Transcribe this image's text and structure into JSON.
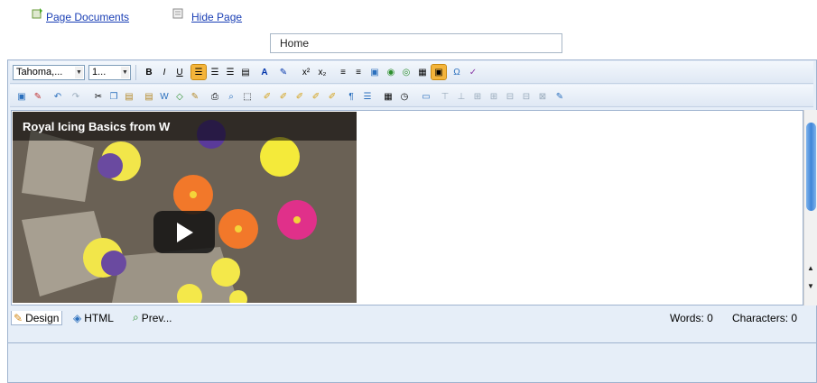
{
  "top": {
    "page_documents": "Page Documents",
    "hide_page": "Hide Page"
  },
  "title_field": {
    "value": "Home"
  },
  "toolbar": {
    "font_family": "Tahoma,...",
    "font_size": "1...",
    "row1_icons": [
      "bold-icon",
      "italic-icon",
      "underline-icon",
      "align-left-icon",
      "align-center-icon",
      "align-right-icon",
      "align-justify-icon",
      "font-color-icon",
      "highlight-color-icon",
      "superscript-icon",
      "subscript-icon",
      "numbered-list-icon",
      "bulleted-list-icon",
      "insert-image-icon",
      "insert-link-icon",
      "remove-link-icon",
      "insert-table-icon",
      "insert-media-icon",
      "insert-symbol-icon",
      "spellcheck-icon"
    ],
    "row2_icons": [
      "new-document-icon",
      "open-icon",
      "undo-icon",
      "redo-icon",
      "cut-icon",
      "copy-icon",
      "paste-icon",
      "paste-text-icon",
      "paste-word-icon",
      "paste-html-icon",
      "format-stripper-icon",
      "print-icon",
      "find-icon",
      "select-all-icon",
      "style-icon-1",
      "style-icon-2",
      "style-icon-3",
      "style-icon-4",
      "style-icon-5",
      "paragraph-icon",
      "horizontal-rule-icon",
      "insert-date-icon",
      "insert-time-icon",
      "table-insert-icon",
      "table-row-above-icon",
      "table-row-below-icon",
      "table-col-left-icon",
      "table-col-right-icon",
      "table-delete-icon",
      "merge-cells-icon",
      "split-cells-icon",
      "table-properties-icon"
    ]
  },
  "video": {
    "title": "Royal Icing Basics from W"
  },
  "modes": {
    "design": "Design",
    "html": "HTML",
    "preview": "Prev..."
  },
  "status": {
    "words": "Words: 0",
    "characters": "Characters: 0"
  },
  "colors": {
    "link": "#1a3fb5",
    "editor_bg": "#e6eef8",
    "border": "#9fb3cf",
    "active_tool": "#f4b43a"
  }
}
